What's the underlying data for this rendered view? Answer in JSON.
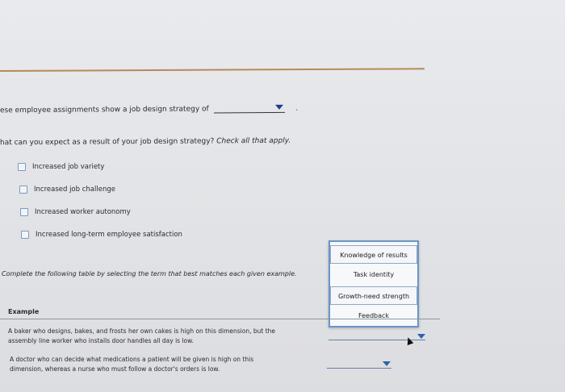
{
  "question1": {
    "prefix": "ese employee assignments show a job design strategy of",
    "selected_value": "",
    "suffix": "."
  },
  "question2": {
    "prefix": "hat can you expect as a result of your job design strategy?",
    "hint": "Check all that apply."
  },
  "options": [
    {
      "label": "Increased job variety",
      "checked": false
    },
    {
      "label": "Increased job challenge",
      "checked": false
    },
    {
      "label": "Increased worker autonomy",
      "checked": false
    },
    {
      "label": "Increased long-term employee satisfaction",
      "checked": false
    }
  ],
  "instruction": "Complete the following table by selecting the term that best matches each given example.",
  "dropdown_menu": {
    "items": [
      "Knowledge of results",
      "Task identity",
      "Growth-need strength",
      "Feedback"
    ]
  },
  "table": {
    "header": "Example",
    "rows": [
      {
        "line1": "A baker who designs, bakes, and frosts her own cakes is high on this dimension, but the",
        "line2": "assembly line worker who installs door handles all day is low."
      },
      {
        "line1": "A doctor who can decide what medications a patient will be given is high on this",
        "line2": "dimension, whereas a nurse who must follow a doctor's orders is low."
      }
    ]
  },
  "colors": {
    "accent": "#2d61b3",
    "panel_border": "#6b95c9",
    "divider": "#b58a5a"
  }
}
